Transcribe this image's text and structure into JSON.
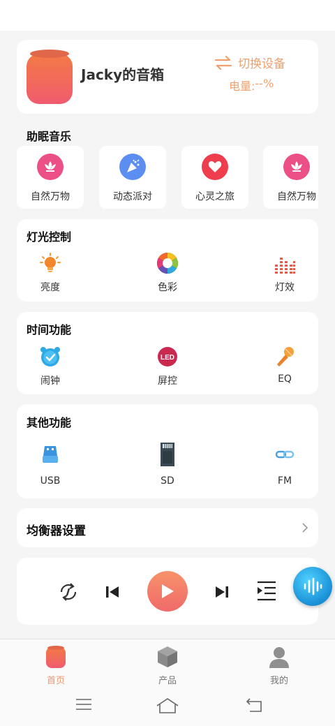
{
  "device": {
    "name": "Jacky的音箱",
    "switch_label": "切换设备",
    "battery_label": "电量:",
    "battery_value": "--%"
  },
  "sleep_music": {
    "title": "助眠音乐",
    "items": [
      {
        "label": "自然万物",
        "icon": "lotus-icon",
        "color": "#ec4f86"
      },
      {
        "label": "动态派对",
        "icon": "party-popper-icon",
        "color": "#5b8ef0"
      },
      {
        "label": "心灵之旅",
        "icon": "heart-icon",
        "color": "#ee3d4c"
      },
      {
        "label": "自然万物",
        "icon": "lotus-icon",
        "color": "#ec4f86"
      }
    ]
  },
  "light": {
    "title": "灯光控制",
    "items": [
      {
        "label": "亮度"
      },
      {
        "label": "色彩"
      },
      {
        "label": "灯效"
      }
    ]
  },
  "time": {
    "title": "时间功能",
    "items": [
      {
        "label": "闹钟"
      },
      {
        "label": "屏控",
        "badge": "LED"
      },
      {
        "label": "EQ"
      }
    ]
  },
  "other": {
    "title": "其他功能",
    "items": [
      {
        "label": "USB"
      },
      {
        "label": "SD"
      },
      {
        "label": "FM"
      }
    ]
  },
  "equalizer": {
    "title": "均衡器设置"
  },
  "tabs": [
    {
      "label": "首页",
      "active": true
    },
    {
      "label": "产品"
    },
    {
      "label": "我的"
    }
  ],
  "colors": {
    "accent": "#f0956d",
    "card": "#ffffff",
    "background": "#f5f5f5"
  }
}
